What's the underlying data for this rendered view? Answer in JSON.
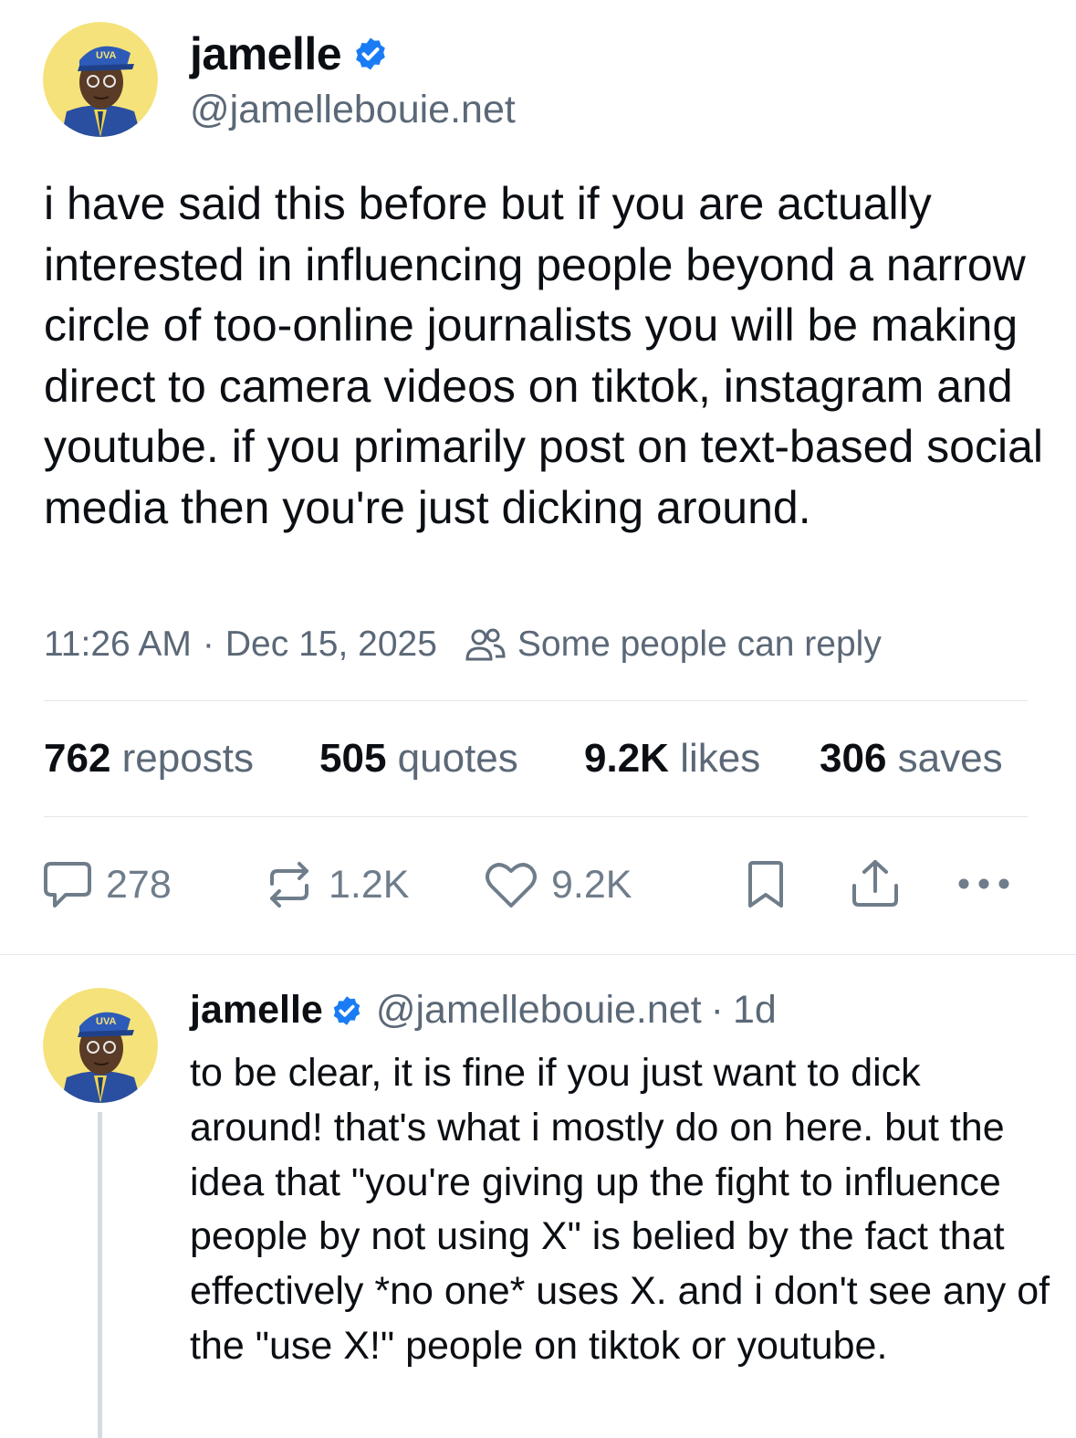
{
  "post": {
    "author": {
      "display_name": "jamelle",
      "handle": "@jamellebouie.net",
      "avatar_text": "UVA",
      "verified_icon": "verified-check-icon"
    },
    "text": "i have said this before but if you are actually interested in influencing people beyond a narrow circle of too-online journalists you will be making direct to camera videos on tiktok, instagram and youtube. if you primarily post on text-based social media then you're just dicking around.",
    "time": "11:26 AM",
    "separator": "·",
    "date": "Dec 15, 2025",
    "reply_setting": "Some people can reply",
    "stats": {
      "reposts": {
        "count": "762",
        "label": "reposts"
      },
      "quotes": {
        "count": "505",
        "label": "quotes"
      },
      "likes": {
        "count": "9.2K",
        "label": "likes"
      },
      "saves": {
        "count": "306",
        "label": "saves"
      }
    },
    "actions": {
      "reply": {
        "icon": "comment-icon",
        "count": "278"
      },
      "repost": {
        "icon": "repost-icon",
        "count": "1.2K"
      },
      "like": {
        "icon": "heart-icon",
        "count": "9.2K"
      },
      "bookmark": {
        "icon": "bookmark-icon"
      },
      "share": {
        "icon": "share-icon"
      },
      "more": {
        "icon": "more-icon"
      }
    }
  },
  "reply": {
    "author": {
      "display_name": "jamelle",
      "handle": "@jamellebouie.net",
      "avatar_text": "UVA"
    },
    "separator": "·",
    "time_ago": "1d",
    "text": "to be clear, it is fine if you just want to dick around! that's what i mostly do on here. but the idea that \"you're giving up the fight to influence people by not using X\" is belied by the fact that effectively *no one* uses X. and i don't see any of the \"use X!\" people on tiktok or youtube."
  },
  "colors": {
    "text_primary": "#0b0f14",
    "text_secondary": "#5b6877",
    "icon_gray": "#6f7d8b",
    "verified_blue": "#1a7cf4",
    "divider": "#e3e7eb"
  }
}
